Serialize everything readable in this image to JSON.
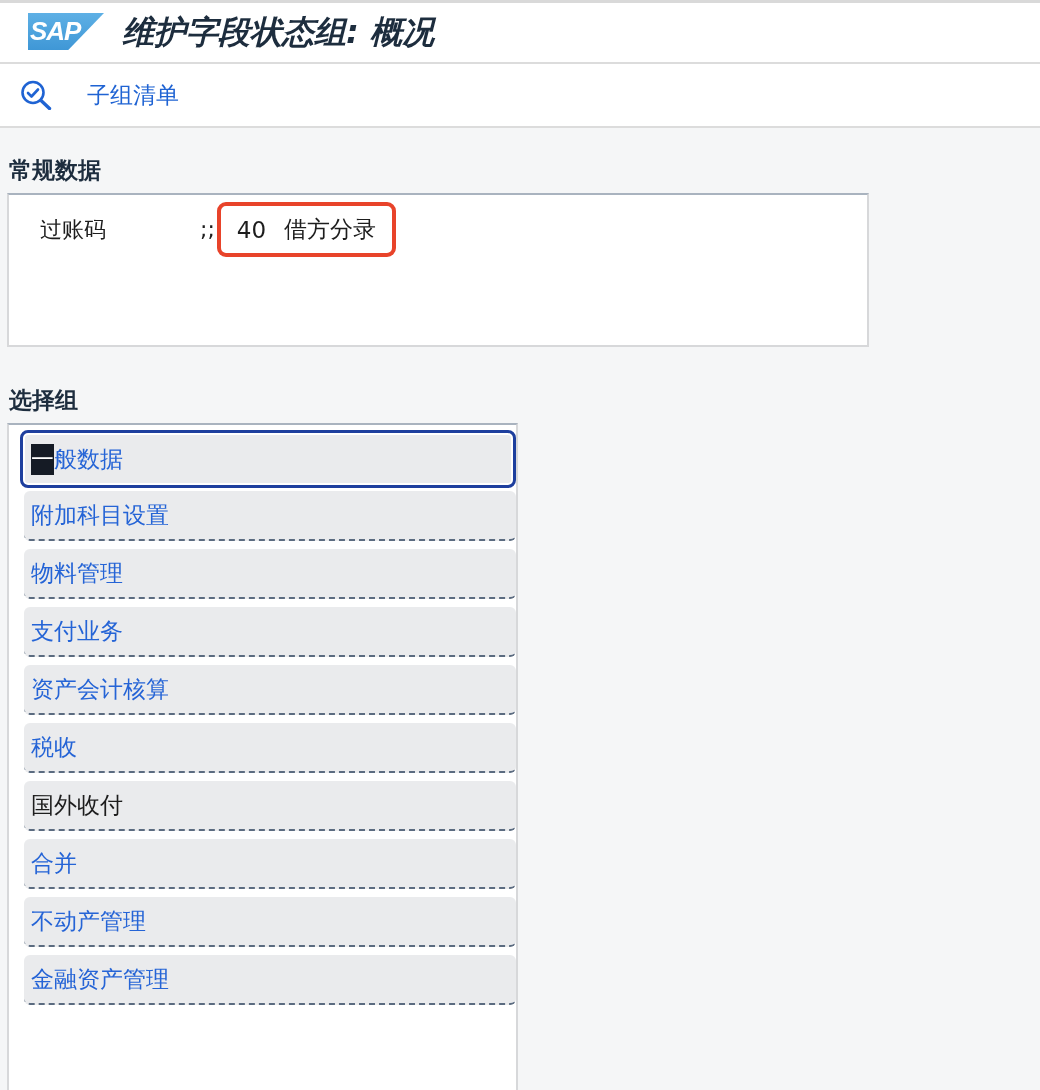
{
  "header": {
    "logo": "SAP",
    "title": "维护字段状态组: 概况"
  },
  "toolbar": {
    "items": [
      {
        "kind": "icon"
      },
      {
        "kind": "text",
        "label": "子组清单"
      }
    ]
  },
  "general_data": {
    "title": "常规数据",
    "fields": [
      {
        "label": "过账码",
        "separator": ";;",
        "value": "40",
        "description": "借方分录",
        "highlighted": true
      }
    ]
  },
  "selection_groups": {
    "title": "选择组",
    "items": [
      {
        "selected_text": "一",
        "label": "般数据",
        "selected": true,
        "kind": "link"
      },
      {
        "label": "附加科目设置",
        "selected": false,
        "kind": "link"
      },
      {
        "label": "物料管理",
        "selected": false,
        "kind": "link"
      },
      {
        "label": "支付业务",
        "selected": false,
        "kind": "link"
      },
      {
        "label": "资产会计核算",
        "selected": false,
        "kind": "link"
      },
      {
        "label": "税收",
        "selected": false,
        "kind": "link"
      },
      {
        "label": "国外收付",
        "selected": false,
        "kind": "plain"
      },
      {
        "label": "合并",
        "selected": false,
        "kind": "link"
      },
      {
        "label": "不动产管理",
        "selected": false,
        "kind": "link"
      },
      {
        "label": "金融资产管理",
        "selected": false,
        "kind": "link"
      }
    ]
  }
}
